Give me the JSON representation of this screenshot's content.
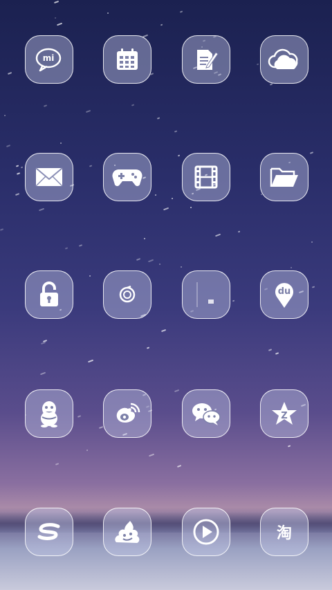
{
  "screen": {
    "name": "home-screen",
    "wallpaper": "starry-night-sky"
  },
  "apps": [
    {
      "id": "mi-talk",
      "icon": "mi-chat-icon",
      "label": "mi"
    },
    {
      "id": "calendar",
      "icon": "calendar-icon"
    },
    {
      "id": "notes",
      "icon": "notes-pencil-icon"
    },
    {
      "id": "cloud",
      "icon": "cloud-icon"
    },
    {
      "id": "mail",
      "icon": "mail-envelope-icon"
    },
    {
      "id": "games",
      "icon": "gamepad-icon"
    },
    {
      "id": "video",
      "icon": "film-strip-icon"
    },
    {
      "id": "files",
      "icon": "folder-icon"
    },
    {
      "id": "lock",
      "icon": "padlock-icon"
    },
    {
      "id": "refresh",
      "icon": "refresh-icon"
    },
    {
      "id": "blank-app",
      "icon": "blank-placeholder-icon"
    },
    {
      "id": "baidu-map",
      "icon": "map-pin-icon",
      "label": "du"
    },
    {
      "id": "qq",
      "icon": "penguin-icon"
    },
    {
      "id": "weibo",
      "icon": "weibo-eye-icon"
    },
    {
      "id": "wechat",
      "icon": "wechat-bubbles-icon"
    },
    {
      "id": "qzone",
      "icon": "star-z-icon",
      "label": "Z"
    },
    {
      "id": "sogou",
      "icon": "s-swoosh-icon",
      "label": "S"
    },
    {
      "id": "sticker",
      "icon": "poop-emoji-icon"
    },
    {
      "id": "player",
      "icon": "play-circle-icon"
    },
    {
      "id": "taobao",
      "icon": "taobao-icon",
      "label": "淘"
    }
  ],
  "colors": {
    "tile_fill": "#c4c8e6",
    "tile_border": "#ffffff",
    "glyph": "#ffffff",
    "sky_top": "#1b2150",
    "sky_bottom": "#c9cadc"
  }
}
